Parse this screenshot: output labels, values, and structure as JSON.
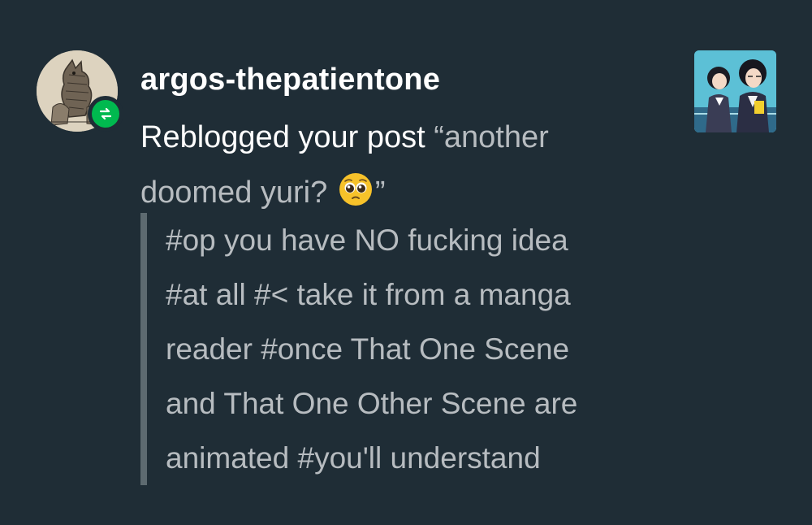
{
  "notification": {
    "username": "argos-thepatientone",
    "action_text": "Reblogged your post ",
    "post_title_open": "“another doomed yuri? ",
    "post_title_emoji": "pleading-face-emoji",
    "post_title_close": "”",
    "tags_lines": [
      "#op you have NO fucking idea",
      "#at all #< take it from a manga",
      "reader #once That One Scene",
      "and That One Other Scene are",
      "animated #you'll understand"
    ],
    "badge_icon": "reblog-icon",
    "colors": {
      "background": "#1f2d36",
      "badge": "#00b94f",
      "muted_text": "#b7bcc0",
      "quote_bar": "#5d6a70"
    }
  }
}
